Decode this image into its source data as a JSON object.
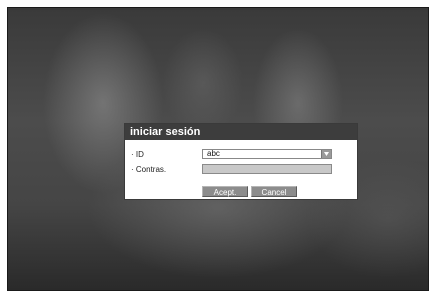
{
  "dialog": {
    "title": "iniciar sesión",
    "id_label": "· ID",
    "id_value": "abc",
    "password_label": "· Contras.",
    "password_value": "",
    "ok_label": "Acept.",
    "cancel_label": "Cancel"
  },
  "icons": {
    "dropdown": "chevron-down-icon"
  },
  "colors": {
    "title_bar": "#3d3d3d",
    "button": "#8c8c8c",
    "password_field": "#c8c8c8"
  }
}
